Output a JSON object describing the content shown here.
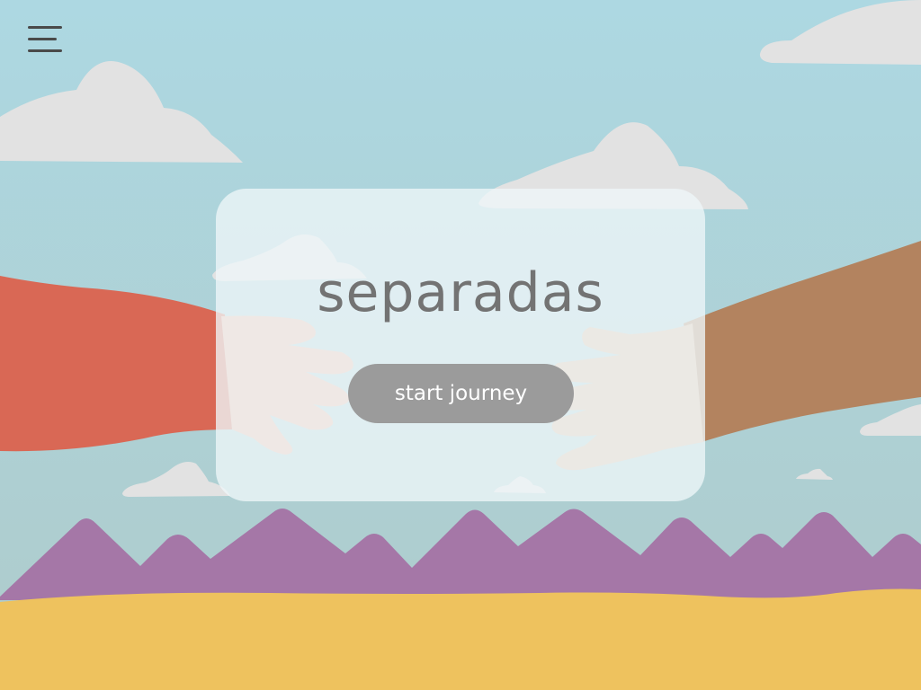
{
  "app": {
    "title": "separadas"
  },
  "hero": {
    "title": "separadas",
    "cta_label": "start journey"
  },
  "colors": {
    "sky_top": "#add8e2",
    "sky_bottom": "#aecbcb",
    "cloud": "#e2e2e2",
    "sleeve_left": "#d96855",
    "sleeve_right": "#b3835f",
    "hand_left": "#f2b79f",
    "hand_right": "#deb999",
    "mountains": "#a577a7",
    "ground": "#eec25e",
    "button": "#9b9b9b",
    "title_text": "#737373"
  },
  "icons": {
    "menu": "hamburger-menu-icon"
  }
}
